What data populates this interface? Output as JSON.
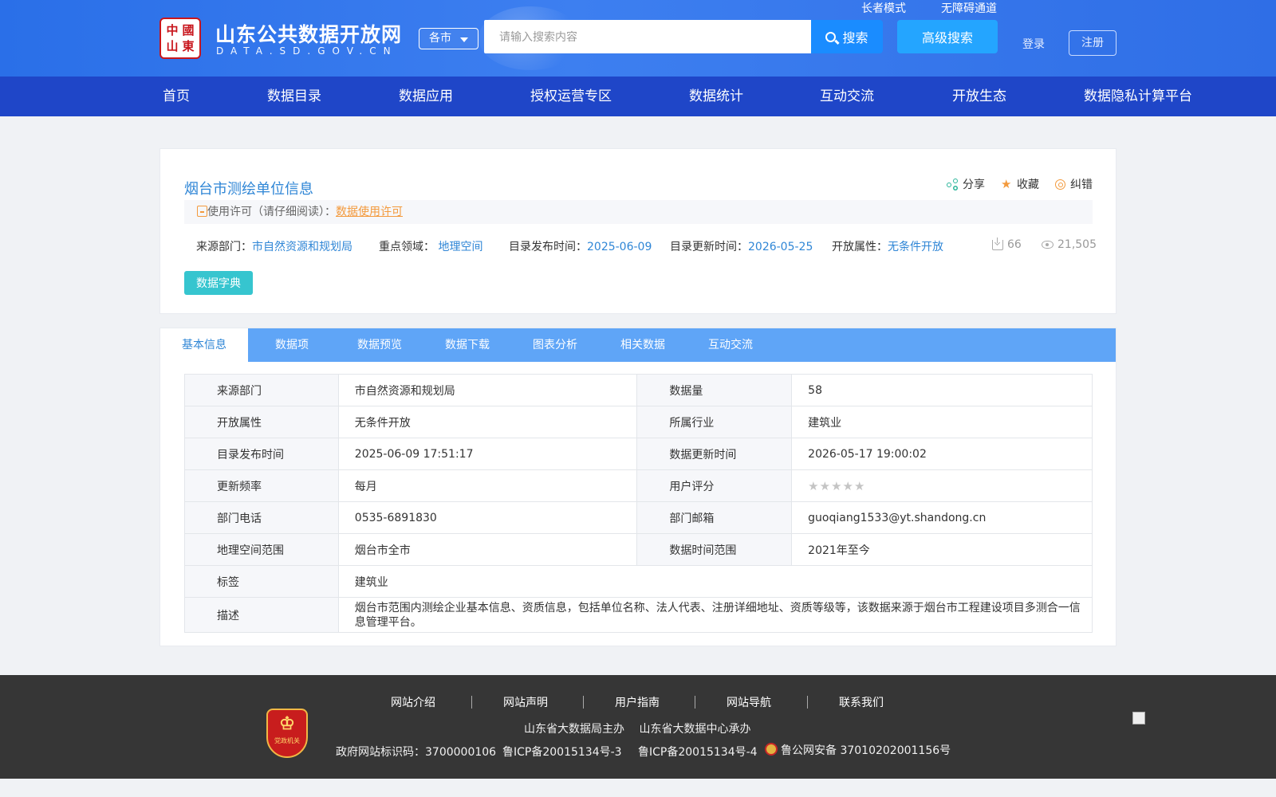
{
  "header": {
    "logo_text": [
      "中",
      "國",
      "山",
      "東"
    ],
    "site_title": "山东公共数据开放网",
    "site_domain": "DATA.SD.GOV.CN",
    "city_select": "各市",
    "search_placeholder": "请输入搜索内容",
    "search_label": "搜索",
    "advanced_search_label": "高级搜索",
    "elder_mode": "长者模式",
    "accessibility": "无障碍通道",
    "login": "登录",
    "register": "注册"
  },
  "nav": [
    "首页",
    "数据目录",
    "数据应用",
    "授权运营专区",
    "数据统计",
    "互动交流",
    "开放生态",
    "数据隐私计算平台"
  ],
  "dataset": {
    "title": "烟台市测绘单位信息",
    "actions": {
      "share": "分享",
      "favorite": "收藏",
      "correct": "纠错"
    },
    "license_prefix": "使用许可（请仔细阅读）：",
    "license_link": "数据使用许可",
    "meta": {
      "source_label": "来源部门：",
      "source_value": "市自然资源和规划局",
      "domain_label": "重点领域：",
      "domain_value": "地理空间",
      "publish_label": "目录发布时间：",
      "publish_value": "2025-06-09",
      "update_label": "目录更新时间：",
      "update_value": "2026-05-25",
      "open_label": "开放属性：",
      "open_value": "无条件开放"
    },
    "downloads": "66",
    "views": "21,505",
    "dictionary_button": "数据字典"
  },
  "tabs": [
    "基本信息",
    "数据项",
    "数据预览",
    "数据下载",
    "图表分析",
    "相关数据",
    "互动交流"
  ],
  "active_tab": "基本信息",
  "info": {
    "source_k": "来源部门",
    "source_v": "市自然资源和规划局",
    "count_k": "数据量",
    "count_v": "58",
    "open_k": "开放属性",
    "open_v": "无条件开放",
    "industry_k": "所属行业",
    "industry_v": "建筑业",
    "publish_k": "目录发布时间",
    "publish_v": "2025-06-09 17:51:17",
    "update_k": "数据更新时间",
    "update_v": "2026-05-17 19:00:02",
    "freq_k": "更新频率",
    "freq_v": "每月",
    "rating_k": "用户评分",
    "rating_value": 0,
    "rating_max": 5,
    "phone_k": "部门电话",
    "phone_v": "0535-6891830",
    "email_k": "部门邮箱",
    "email_v": "guoqiang1533@yt.shandong.cn",
    "geo_k": "地理空间范围",
    "geo_v": "烟台市全市",
    "timerange_k": "数据时间范围",
    "timerange_v": "2021年至今",
    "tag_k": "标签",
    "tag_v": "建筑业",
    "desc_k": "描述",
    "desc_v": "烟台市范围内测绘企业基本信息、资质信息，包括单位名称、法人代表、注册详细地址、资质等级等，该数据来源于烟台市工程建设项目多测合一信息管理平台。"
  },
  "footer": {
    "badge_text": "党政机关",
    "links": [
      "网站介绍",
      "网站声明",
      "用户指南",
      "网站导航",
      "联系我们"
    ],
    "organizers": "山东省大数据局主办　 山东省大数据中心承办",
    "gov_id": "政府网站标识码：3700000106",
    "icp1": "鲁ICP备20015134号-3",
    "icp2": "鲁ICP备20015134号-4",
    "police": "鲁公网安备 37010202001156号"
  }
}
